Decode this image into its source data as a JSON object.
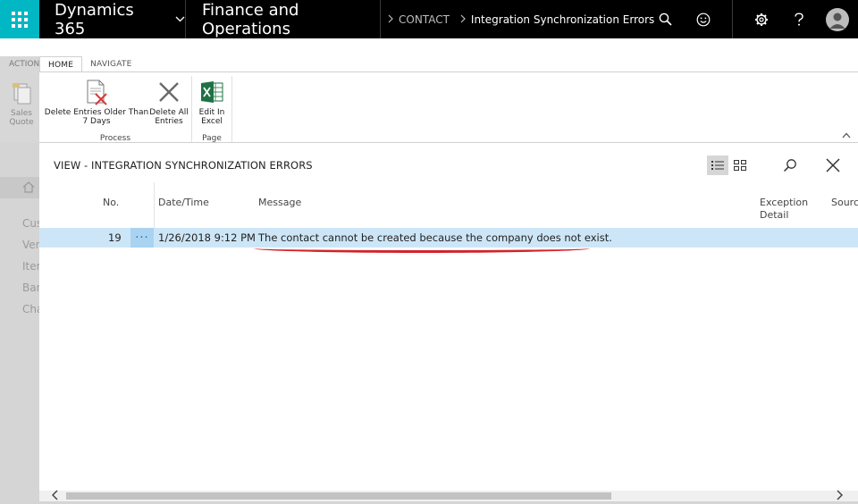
{
  "topbar": {
    "product": "Dynamics 365",
    "app": "Finance and Operations",
    "breadcrumb_parent": "CONTACT",
    "breadcrumb_current": "Integration Synchronization Errors"
  },
  "background": {
    "action_tab": "ACTION",
    "sales_quote": "Sales Quote",
    "nav_items": [
      "Cus",
      "Ven",
      "Item",
      "Ban",
      "Cha"
    ]
  },
  "ribbon": {
    "tabs": [
      "HOME",
      "NAVIGATE"
    ],
    "buttons": {
      "delete_older": "Delete Entries Older Than 7 Days",
      "delete_all": "Delete All Entries",
      "edit_excel": "Edit In Excel"
    },
    "groups": {
      "process": "Process",
      "page": "Page"
    }
  },
  "view": {
    "title": "VIEW - INTEGRATION SYNCHRONIZATION ERRORS"
  },
  "grid": {
    "columns": {
      "no": "No.",
      "datetime": "Date/Time",
      "message": "Message",
      "exception": "Exception Detail",
      "source": "Source"
    },
    "rows": [
      {
        "no": "19",
        "actions": "···",
        "datetime": "1/26/2018 9:12 PM",
        "message": "The contact cannot be created because the company does not exist."
      }
    ]
  },
  "colors": {
    "waffle": "#00b7c3",
    "topbar": "#000000",
    "row_selected": "#cde6f7",
    "annotation": "#d2232a"
  }
}
